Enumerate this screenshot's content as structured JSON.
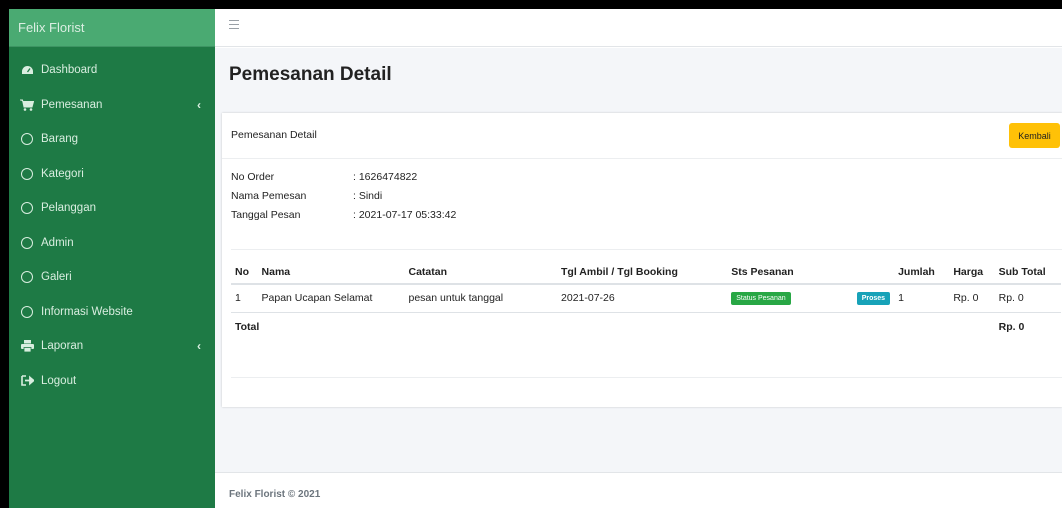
{
  "sidebar": {
    "brand": "Felix Florist",
    "items": [
      {
        "label": "Dashboard",
        "icon": "tachometer-icon",
        "has_chevron": false
      },
      {
        "label": "Pemesanan",
        "icon": "cart-icon",
        "has_chevron": true
      },
      {
        "label": "Barang",
        "icon": "circle-icon",
        "has_chevron": false
      },
      {
        "label": "Kategori",
        "icon": "circle-icon",
        "has_chevron": false
      },
      {
        "label": "Pelanggan",
        "icon": "circle-icon",
        "has_chevron": false
      },
      {
        "label": "Admin",
        "icon": "circle-icon",
        "has_chevron": false
      },
      {
        "label": "Galeri",
        "icon": "circle-icon",
        "has_chevron": false
      },
      {
        "label": "Informasi Website",
        "icon": "circle-icon",
        "has_chevron": false
      },
      {
        "label": "Laporan",
        "icon": "print-icon",
        "has_chevron": true
      },
      {
        "label": "Logout",
        "icon": "sign-out-icon",
        "has_chevron": false
      }
    ],
    "chevron": "‹"
  },
  "header": {
    "page_title": "Pemesanan Detail"
  },
  "card": {
    "title": "Pemesanan Detail",
    "back_button": "Kembali"
  },
  "info": [
    {
      "label": "No Order",
      "value": ": 1626474822"
    },
    {
      "label": "Nama Pemesan",
      "value": ": Sindi"
    },
    {
      "label": "Tanggal Pesan",
      "value": ": 2021-07-17 05:33:42"
    }
  ],
  "table": {
    "headers": [
      "No",
      "Nama",
      "Catatan",
      "Tgl Ambil / Tgl Booking",
      "Sts Pesanan",
      "",
      "Jumlah",
      "Harga",
      "Sub Total"
    ],
    "rows": [
      {
        "no": "1",
        "nama": "Papan Ucapan Selamat",
        "catatan": "pesan untuk tanggal",
        "tgl": "2021-07-26",
        "status_button": "Status Pesanan",
        "status_badge": "Proses",
        "jumlah": "1",
        "harga": "Rp. 0",
        "subtotal": "Rp. 0"
      }
    ],
    "total_label": "Total",
    "total_value": "Rp. 0"
  },
  "footer": {
    "text": "Felix Florist © 2021"
  },
  "colors": {
    "sidebar": "#1e7a45",
    "brand": "#4aaa72",
    "warning": "#ffc107",
    "success": "#28a745",
    "info": "#17a2b8"
  }
}
